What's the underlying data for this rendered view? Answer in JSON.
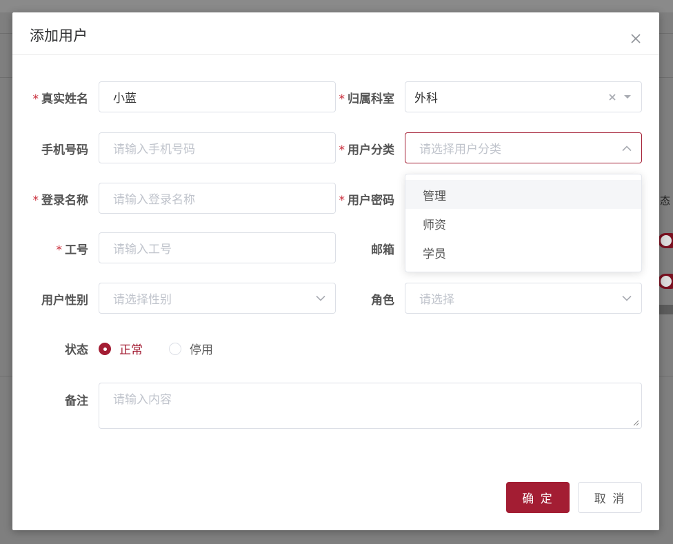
{
  "background": {
    "column_header_partial": "态"
  },
  "dialog": {
    "title": "添加用户",
    "fields": {
      "real_name": {
        "label": "真实姓名",
        "value": "小蓝"
      },
      "department": {
        "label": "归属科室",
        "value": "外科"
      },
      "phone": {
        "label": "手机号码",
        "placeholder": "请输入手机号码"
      },
      "user_category": {
        "label": "用户分类",
        "placeholder": "请选择用户分类"
      },
      "login_name": {
        "label": "登录名称",
        "placeholder": "请输入登录名称"
      },
      "password": {
        "label": "用户密码"
      },
      "employee_id": {
        "label": "工号",
        "placeholder": "请输入工号"
      },
      "email": {
        "label": "邮箱"
      },
      "gender": {
        "label": "用户性别",
        "placeholder": "请选择性别"
      },
      "role": {
        "label": "角色",
        "placeholder": "请选择"
      },
      "status": {
        "label": "状态",
        "options": [
          "正常",
          "停用"
        ],
        "selected": "正常"
      },
      "remark": {
        "label": "备注",
        "placeholder": "请输入内容"
      }
    },
    "category_dropdown": {
      "options": [
        "管理",
        "师资",
        "学员"
      ],
      "hovered": "管理"
    },
    "buttons": {
      "confirm": "确 定",
      "cancel": "取 消"
    }
  },
  "colors": {
    "accent": "#a31d33",
    "required_mark": "#c92c3a",
    "placeholder": "#c0c4cc",
    "border": "#dcdfe6"
  }
}
